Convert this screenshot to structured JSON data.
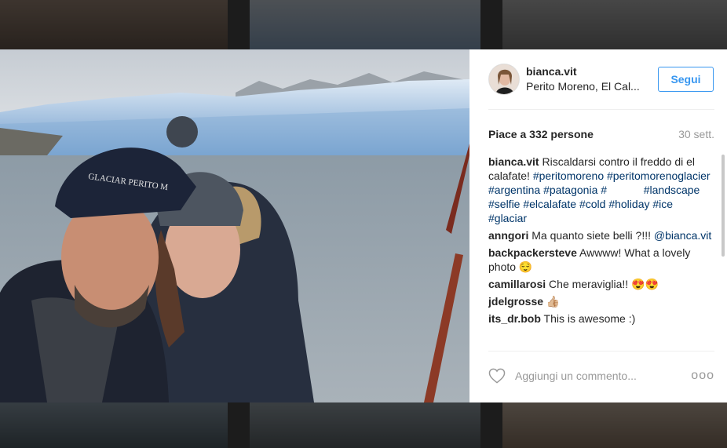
{
  "post": {
    "username": "bianca.vit",
    "location": "Perito Moreno, El Cal...",
    "follow_label": "Segui",
    "likes": "Piace a 332 persone",
    "date": "30 sett.",
    "comments": [
      {
        "user": "bianca.vit",
        "parts": [
          {
            "t": "text",
            "v": " Riscaldarsi contro il freddo di el calafate! "
          },
          {
            "t": "tag",
            "v": "#peritomoreno"
          },
          {
            "t": "text",
            "v": " "
          },
          {
            "t": "tag",
            "v": "#peritomorenoglacier"
          },
          {
            "t": "text",
            "v": " "
          },
          {
            "t": "tag",
            "v": "#argentina"
          },
          {
            "t": "text",
            "v": " "
          },
          {
            "t": "tag",
            "v": "#patagonia"
          },
          {
            "t": "text",
            "v": " "
          },
          {
            "t": "tag",
            "v": "#"
          },
          {
            "t": "text",
            "v": "            "
          },
          {
            "t": "tag",
            "v": "#landscape"
          },
          {
            "t": "text",
            "v": " "
          },
          {
            "t": "tag",
            "v": "#selfie"
          },
          {
            "t": "text",
            "v": " "
          },
          {
            "t": "tag",
            "v": "#elcalafate"
          },
          {
            "t": "text",
            "v": " "
          },
          {
            "t": "tag",
            "v": "#cold"
          },
          {
            "t": "text",
            "v": " "
          },
          {
            "t": "tag",
            "v": "#holiday"
          },
          {
            "t": "text",
            "v": " "
          },
          {
            "t": "tag",
            "v": "#ice"
          },
          {
            "t": "text",
            "v": " "
          },
          {
            "t": "tag",
            "v": "#glaciar"
          }
        ]
      },
      {
        "user": "anngori",
        "parts": [
          {
            "t": "text",
            "v": " Ma quanto siete belli ?!!! "
          },
          {
            "t": "tag",
            "v": "@bianca.vit"
          }
        ]
      },
      {
        "user": "backpackersteve",
        "parts": [
          {
            "t": "text",
            "v": " Awwww! What a lovely photo 😌"
          }
        ]
      },
      {
        "user": "camillarosi",
        "parts": [
          {
            "t": "text",
            "v": " Che meraviglia!! 😍😍"
          }
        ]
      },
      {
        "user": "jdelgrosse",
        "parts": [
          {
            "t": "text",
            "v": " 👍🏼"
          }
        ]
      },
      {
        "user": "its_dr.bob",
        "parts": [
          {
            "t": "text",
            "v": " This is awesome :)"
          }
        ]
      }
    ],
    "comment_placeholder": "Aggiungi un commento...",
    "more_label": "ooo"
  },
  "colors": {
    "accent": "#3897f0",
    "hashtag": "#003569",
    "muted": "#999999"
  },
  "icons": {
    "like": "heart-outline-icon",
    "options": "more-options-icon"
  }
}
